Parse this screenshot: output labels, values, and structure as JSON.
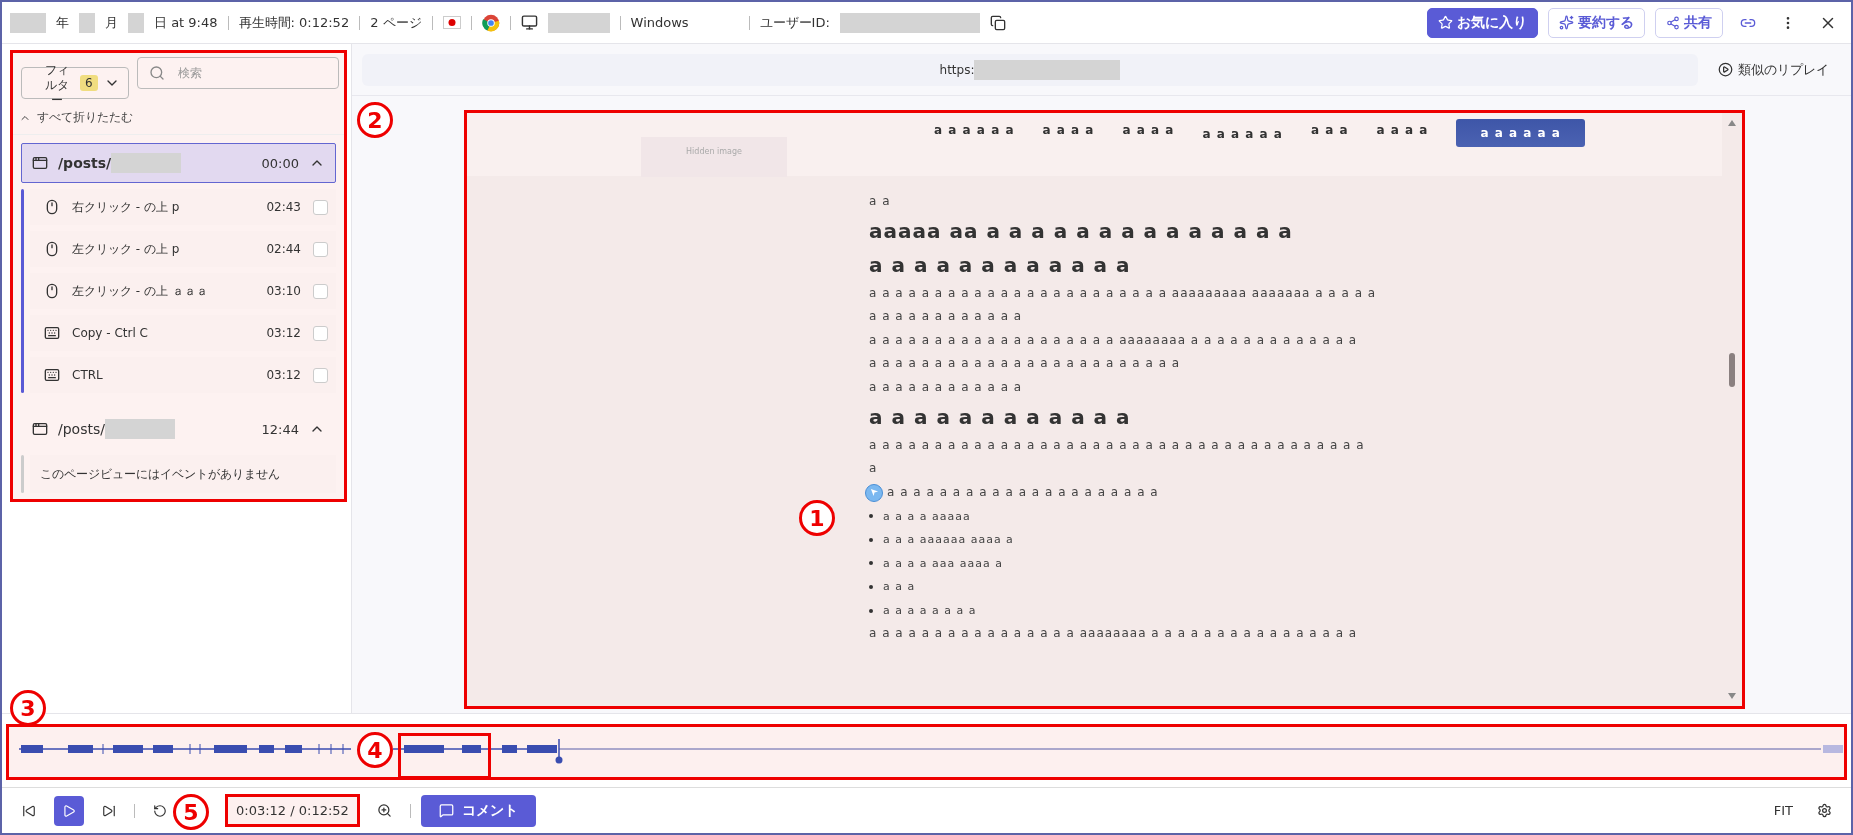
{
  "header": {
    "date_parts": [
      "年",
      "月",
      "日 at 9:48"
    ],
    "play_time": "再生時間: 0:12:52",
    "pages": "2 ページ",
    "os": "Windows",
    "user_id_label": "ユーザーID:"
  },
  "actions": [
    {
      "label": "お気に入り",
      "kind": "primary"
    },
    {
      "label": "要約する",
      "kind": "outline"
    },
    {
      "label": "共有",
      "kind": "outline"
    }
  ],
  "sidebar": {
    "filter": {
      "label": "フィルター",
      "count": "6"
    },
    "search": {
      "placeholder": "検索"
    },
    "collapse_all": "すべて折りたたむ",
    "pages": [
      {
        "path": "/posts/",
        "time": "00:00",
        "expanded": true,
        "selected": true,
        "events": [
          {
            "kind": "mouse",
            "label": "右クリック - の上 p",
            "time": "02:43",
            "checked": false
          },
          {
            "kind": "mouse",
            "label": "左クリック - の上 p",
            "time": "02:44",
            "checked": false
          },
          {
            "kind": "mouse",
            "label": "左クリック - の上 ａａａ",
            "time": "03:10",
            "checked": false
          },
          {
            "kind": "keyboard",
            "label": "Copy - Ctrl C",
            "time": "03:12",
            "checked": false
          },
          {
            "kind": "keyboard",
            "label": "CTRL",
            "time": "03:12",
            "checked": false
          }
        ]
      },
      {
        "path": "/posts/",
        "time": "12:44",
        "expanded": true,
        "selected": false,
        "empty_message": "このページビューにはイベントがありません"
      }
    ]
  },
  "url": {
    "prefix": "https:"
  },
  "similar_replays": "類似のリプレイ",
  "replay": {
    "nav_items": [
      "a a a a a a",
      "a a a a",
      "a a a a",
      "a a a a a a",
      "a a a",
      "a a a a"
    ],
    "nav_button": "a a a a a a",
    "hidden_image": "Hidden image",
    "blocks": [
      {
        "kind": "text",
        "text": "a a"
      },
      {
        "kind": "heading",
        "text": "aaaaa aa a a a a a a a a a a a a a a"
      },
      {
        "kind": "heading",
        "text": "a a a a a a a a a a a a"
      },
      {
        "kind": "text",
        "text": "a a a a a a a a a a a a a a a a a a a a a a a aaaaaaaaa aaaaaaa a a a a a"
      },
      {
        "kind": "text",
        "text": "a a a a a a a a a a a a"
      },
      {
        "kind": "text",
        "text": "a a a a a a a a a a a a a a a a a a a aaaaaaaa a a a a a a a a a a a a a"
      },
      {
        "kind": "text",
        "text": "a a a a a a a a a a a a a a a a a a a a a a a a"
      },
      {
        "kind": "text",
        "text": "a a a a a a a a a a a a"
      },
      {
        "kind": "heading",
        "text": "a a a a a a a a a a a a"
      },
      {
        "kind": "text",
        "text": "a a a a a a a a a a a a a a a a a a a a a a a a a a a a a a a a a a a a a a"
      },
      {
        "kind": "text",
        "text": "a"
      },
      {
        "kind": "text",
        "text": "a a a a a a a a a a a a a a a a a a a a a",
        "cursor": true
      },
      {
        "kind": "bullet",
        "text": "a a a a aaaaa"
      },
      {
        "kind": "bullet",
        "text": "a a a aaaaaa aaaa a"
      },
      {
        "kind": "bullet",
        "text": "a a a a aaa aaaa a"
      },
      {
        "kind": "bullet",
        "text": "a a a"
      },
      {
        "kind": "bullet",
        "text": "a a a a a a a a"
      },
      {
        "kind": "text",
        "text": "a a a a a a a a a a a a a a a a aaaaaaaa a a a a a a a a a a a a a a a a"
      }
    ]
  },
  "timeline": {
    "level": 0.3
  },
  "controls": {
    "time": "0:03:12 / 0:12:52",
    "comment": "コメント",
    "fit": "FIT"
  },
  "annotations": [
    "1",
    "2",
    "3",
    "4",
    "5"
  ]
}
